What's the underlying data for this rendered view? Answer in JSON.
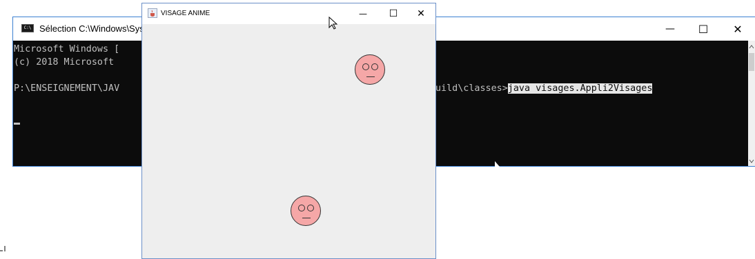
{
  "console": {
    "title": "Sélection C:\\Windows\\System32\\cmd.exe",
    "icon": "cmd-app-icon",
    "icon_label": "C:\\",
    "controls": {
      "minimize": "—",
      "maximize": "☐",
      "close": "✕"
    },
    "lines": [
      {
        "left": "Microsoft Windows [",
        "right": ""
      },
      {
        "left": "(c) 2018 Microsoft",
        "right": ""
      },
      {
        "left": "",
        "right": ""
      },
      {
        "left": "P:\\ENSEIGNEMENT\\JAV",
        "right": "uild\\classes>",
        "command": "java visages.Appli2Visages"
      }
    ]
  },
  "java_frame": {
    "title": "VISAGE ANIME",
    "icon": "java-cup-icon",
    "controls": {
      "minimize": "—",
      "maximize": "☐",
      "close": "✕"
    },
    "faces": [
      {
        "name": "face-top-right"
      },
      {
        "name": "face-bottom"
      }
    ]
  },
  "colors": {
    "console_bg": "#0c0c0c",
    "console_text": "#c0c0c0",
    "selection_bg": "#e6e6e6",
    "frame_bg": "#eeeeee",
    "face_fill": "#f5a7a7",
    "window_border": "#3b7fd2"
  }
}
